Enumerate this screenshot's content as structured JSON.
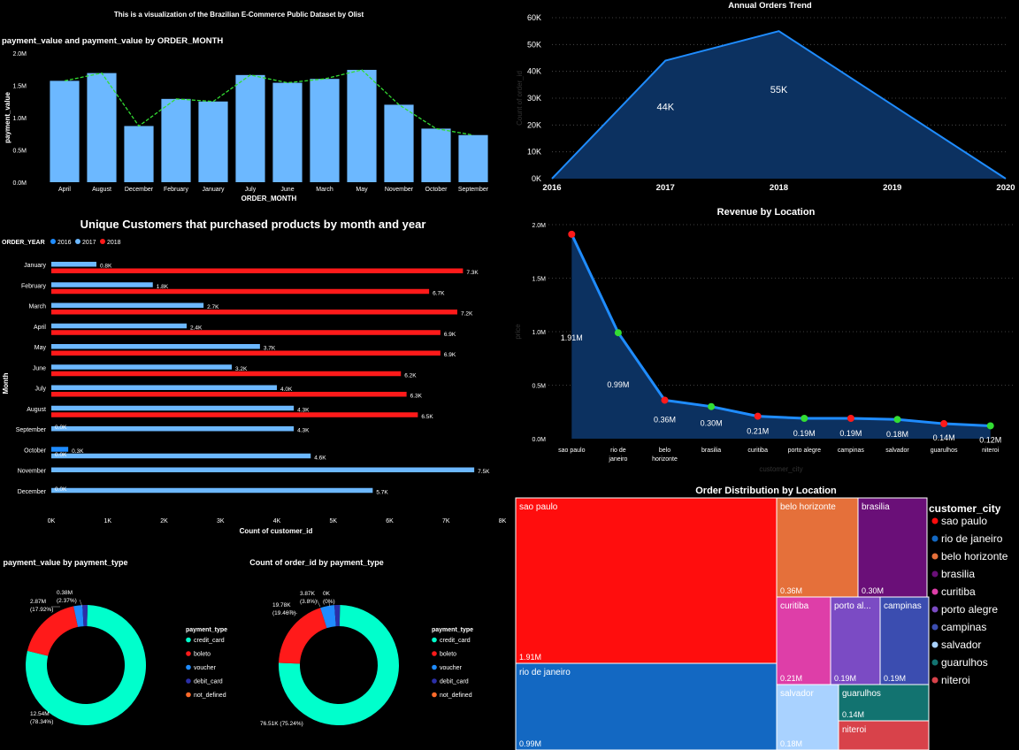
{
  "dashboard": {
    "title": "This is a visualization of the Brazilian E-Commerce Public Dataset by Olist"
  },
  "colors": {
    "light_blue": "#6cb8ff",
    "blue": "#1f8cff",
    "red": "#ff1a1a",
    "teal": "#00ffcc",
    "green": "#33dd33",
    "navy": "#0c3160",
    "bg": "#000000"
  },
  "chart_data": [
    {
      "id": "monthly_payment",
      "type": "bar",
      "title": "payment_value and payment_value by ORDER_MONTH",
      "xlabel": "ORDER_MONTH",
      "ylabel": "payment_value",
      "ylim": [
        0,
        2000000
      ],
      "yticks": [
        "0.0M",
        "0.5M",
        "1.0M",
        "1.5M",
        "2.0M"
      ],
      "categories": [
        "April",
        "August",
        "December",
        "February",
        "January",
        "July",
        "June",
        "March",
        "May",
        "November",
        "October",
        "September"
      ],
      "values": [
        1570000,
        1690000,
        870000,
        1290000,
        1250000,
        1660000,
        1540000,
        1600000,
        1740000,
        1200000,
        830000,
        730000
      ],
      "line_values": [
        1570000,
        1690000,
        870000,
        1290000,
        1250000,
        1660000,
        1540000,
        1600000,
        1740000,
        1200000,
        830000,
        730000
      ]
    },
    {
      "id": "annual_orders",
      "type": "area",
      "title": "Annual Orders Trend",
      "ylabel": "Count of order_id",
      "x": [
        2016,
        2017,
        2018,
        2019,
        2020
      ],
      "values": [
        0,
        44000,
        55000,
        27500,
        0
      ],
      "ylim": [
        0,
        60000
      ],
      "yticks": [
        "0K",
        "10K",
        "20K",
        "30K",
        "40K",
        "50K",
        "60K"
      ],
      "xticks": [
        "2016",
        "2017",
        "2018",
        "2019",
        "2020"
      ],
      "labels": [
        {
          "text": "44K",
          "index": 1
        },
        {
          "text": "55K",
          "index": 2
        }
      ]
    },
    {
      "id": "unique_customers",
      "type": "bar",
      "orientation": "horizontal",
      "title": "Unique Customers that purchased products by month and year",
      "legend_title": "ORDER_YEAR",
      "ylabel": "Month",
      "xlabel": "Count of customer_id",
      "xlim": [
        0,
        8000
      ],
      "xticks": [
        "0K",
        "1K",
        "2K",
        "3K",
        "4K",
        "5K",
        "6K",
        "7K",
        "8K"
      ],
      "categories": [
        "January",
        "February",
        "March",
        "April",
        "May",
        "June",
        "July",
        "August",
        "September",
        "October",
        "November",
        "December"
      ],
      "series": [
        {
          "name": "2016",
          "values": [
            0,
            0,
            0,
            0,
            0,
            0,
            0,
            0,
            0,
            300,
            0,
            0
          ],
          "labels": [
            "",
            "",
            "",
            "",
            "",
            "",
            "",
            "",
            "",
            "0.3K",
            "",
            ""
          ]
        },
        {
          "name": "2017",
          "values": [
            800,
            1800,
            2700,
            2400,
            3700,
            3200,
            4000,
            4300,
            4300,
            4600,
            7500,
            5700
          ],
          "labels": [
            "0.8K",
            "1.8K",
            "2.7K",
            "2.4K",
            "3.7K",
            "3.2K",
            "4.0K",
            "4.3K",
            "4.3K",
            "4.6K",
            "7.5K",
            "5.7K"
          ]
        },
        {
          "name": "2018",
          "values": [
            7300,
            6700,
            7200,
            6900,
            6900,
            6200,
            6300,
            6500,
            0,
            0,
            0,
            0
          ],
          "labels": [
            "7.3K",
            "6.7K",
            "7.2K",
            "6.9K",
            "6.9K",
            "6.2K",
            "6.3K",
            "6.5K",
            "0.0K",
            "0.0K",
            "",
            ""
          ]
        }
      ],
      "zero_labels": [
        {
          "text": "0.0K",
          "row": 8,
          "slot": 0
        },
        {
          "text": "0.0K",
          "row": 9,
          "slot": 1
        },
        {
          "text": "0.0K",
          "row": 11,
          "slot": 0
        }
      ]
    },
    {
      "id": "revenue_location",
      "type": "area",
      "title": "Revenue by Location",
      "xlabel": "customer_city",
      "ylabel": "price",
      "ylim": [
        0,
        2000000
      ],
      "yticks": [
        "0.0M",
        "0.5M",
        "1.0M",
        "1.5M",
        "2.0M"
      ],
      "categories": [
        "sao paulo",
        "rio de janeiro",
        "belo horizonte",
        "brasilia",
        "curitiba",
        "porto alegre",
        "campinas",
        "salvador",
        "guarulhos",
        "niteroi"
      ],
      "cat_lines": [
        [
          "sao paulo"
        ],
        [
          "rio de",
          "janeiro"
        ],
        [
          "belo",
          "horizonte"
        ],
        [
          "brasilia"
        ],
        [
          "curitiba"
        ],
        [
          "porto alegre"
        ],
        [
          "campinas"
        ],
        [
          "salvador"
        ],
        [
          "guarulhos"
        ],
        [
          "niteroi"
        ]
      ],
      "values": [
        1910000,
        990000,
        360000,
        300000,
        210000,
        190000,
        190000,
        180000,
        140000,
        120000
      ],
      "labels": [
        "1.91M",
        "0.99M",
        "0.36M",
        "0.30M",
        "0.21M",
        "0.19M",
        "0.19M",
        "0.18M",
        "0.14M",
        "0.12M"
      ],
      "marker_colors": [
        "#ff1a1a",
        "#33dd33",
        "#ff1a1a",
        "#33dd33",
        "#ff1a1a",
        "#33dd33",
        "#ff1a1a",
        "#33dd33",
        "#ff1a1a",
        "#33dd33"
      ]
    },
    {
      "id": "order_distribution",
      "type": "treemap",
      "title": "Order Distribution by Location",
      "legend_title": "customer_city",
      "items": [
        {
          "name": "sao paulo",
          "label": "sao paulo",
          "value_label": "1.91M",
          "value": 1910000,
          "color": "#ff0d0d"
        },
        {
          "name": "rio de janeiro",
          "label": "rio de janeiro",
          "value_label": "0.99M",
          "value": 990000,
          "color": "#1368c2"
        },
        {
          "name": "belo horizonte",
          "label": "belo horizonte",
          "value_label": "0.36M",
          "value": 360000,
          "color": "#e5703a"
        },
        {
          "name": "brasilia",
          "label": "brasilia",
          "value_label": "0.30M",
          "value": 300000,
          "color": "#6a0f78"
        },
        {
          "name": "curitiba",
          "label": "curitiba",
          "value_label": "0.21M",
          "value": 210000,
          "color": "#de3ea8"
        },
        {
          "name": "porto alegre",
          "label": "porto al...",
          "value_label": "0.19M",
          "value": 190000,
          "color": "#7b4bc4"
        },
        {
          "name": "campinas",
          "label": "campinas",
          "value_label": "0.19M",
          "value": 190000,
          "color": "#3b4db0"
        },
        {
          "name": "salvador",
          "label": "salvador",
          "value_label": "0.18M",
          "value": 180000,
          "color": "#a9d2ff"
        },
        {
          "name": "guarulhos",
          "label": "guarulhos",
          "value_label": "0.14M",
          "value": 140000,
          "color": "#127370"
        },
        {
          "name": "niteroi",
          "label": "niteroi",
          "value_label": "",
          "value": 120000,
          "color": "#d8424a"
        }
      ]
    },
    {
      "id": "payment_value_type",
      "type": "pie",
      "donut": true,
      "title": "payment_value by payment_type",
      "legend_title": "payment_type",
      "slices": [
        {
          "name": "credit_card",
          "value": 12540000,
          "label": [
            "12.54M",
            "(78.34%)"
          ],
          "color": "#00ffcc"
        },
        {
          "name": "boleto",
          "value": 2870000,
          "label": [
            "2.87M",
            "(17.92%)"
          ],
          "color": "#ff1a1a"
        },
        {
          "name": "voucher",
          "value": 380000,
          "label": [
            "0.38M",
            "(2.37%)"
          ],
          "color": "#1f8cff"
        },
        {
          "name": "debit_card",
          "value": 220000,
          "label": [],
          "color": "#2b2fa8"
        },
        {
          "name": "not_defined",
          "value": 0,
          "label": [],
          "color": "#ff6a2a"
        }
      ]
    },
    {
      "id": "order_count_type",
      "type": "pie",
      "donut": true,
      "title": "Count of order_id by payment_type",
      "legend_title": "payment_type",
      "slices": [
        {
          "name": "credit_card",
          "value": 76510,
          "label": [
            "76.51K (75.24%)"
          ],
          "color": "#00ffcc"
        },
        {
          "name": "boleto",
          "value": 19780,
          "label": [
            "19.78K",
            "(19.46%)"
          ],
          "color": "#ff1a1a"
        },
        {
          "name": "voucher",
          "value": 3870,
          "label": [
            "3.87K",
            "(3.8%)"
          ],
          "color": "#1f8cff"
        },
        {
          "name": "debit_card",
          "value": 1500,
          "label": [],
          "color": "#2b2fa8"
        },
        {
          "name": "not_defined",
          "value": 3,
          "label": [
            "0K",
            "(0%)"
          ],
          "color": "#ff6a2a"
        }
      ]
    }
  ]
}
